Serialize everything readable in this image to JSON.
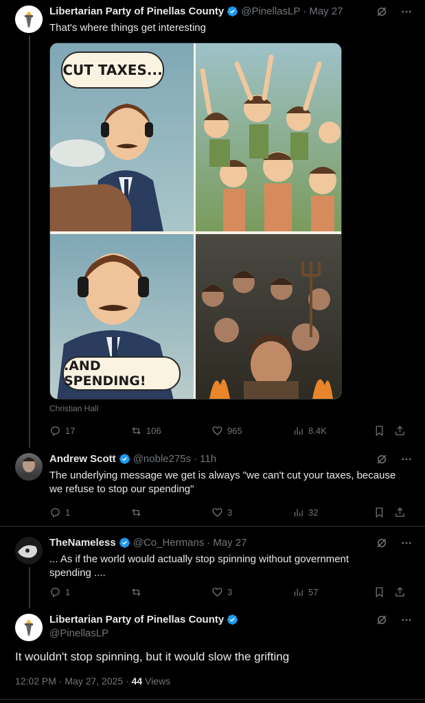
{
  "tweets": [
    {
      "name": "Libertarian Party of Pinellas County",
      "handle": "@PinellasLP",
      "time": "May 27",
      "text": "That's where things get interesting",
      "credit": "Christian Hall",
      "comic": {
        "bubble1": "CUT TAXES...",
        "bubble2": ".AND SPENDING!"
      },
      "stats": {
        "replies": "17",
        "reposts": "106",
        "likes": "965",
        "views": "8.4K"
      }
    },
    {
      "name": "Andrew Scott",
      "handle": "@noble275s",
      "time": "11h",
      "text_lines": [
        "The underlying message we get is always \"we can't cut your taxes, because",
        "we refuse to stop our spending\""
      ],
      "stats": {
        "replies": "1",
        "reposts": "",
        "likes": "3",
        "views": "32"
      }
    },
    {
      "name": "TheNameless",
      "handle": "@Co_Hermans",
      "time": "May 27",
      "text_lines": [
        "... As if the world would actually stop spinning without government",
        "spending ...."
      ],
      "stats": {
        "replies": "1",
        "reposts": "",
        "likes": "3",
        "views": "57"
      }
    },
    {
      "name": "Libertarian Party of Pinellas County",
      "handle": "@PinellasLP",
      "text": "It wouldn't stop spinning, but it would slow the grifting",
      "timestamp": "12:02 PM · May 27, 2025 · ",
      "views_count": "44",
      "views_label": "Views"
    }
  ],
  "colors": {
    "background": "#000000",
    "text": "#e7e9ea",
    "muted": "#71767b",
    "verified": "#1d9bf0"
  }
}
